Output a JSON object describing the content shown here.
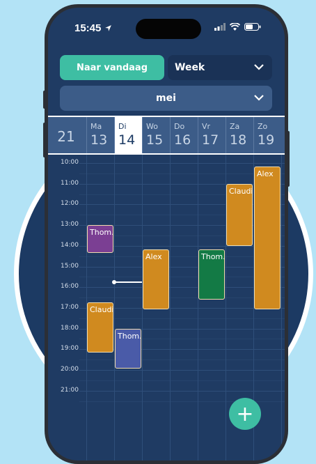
{
  "status_bar": {
    "time": "15:45"
  },
  "header": {
    "today_button": "Naar vandaag",
    "view_select": "Week",
    "month_select": "mei"
  },
  "week": {
    "number": "21",
    "days": [
      {
        "name": "Ma",
        "date": "13",
        "today": false
      },
      {
        "name": "Di",
        "date": "14",
        "today": true
      },
      {
        "name": "Wo",
        "date": "15",
        "today": false
      },
      {
        "name": "Do",
        "date": "16",
        "today": false
      },
      {
        "name": "Vr",
        "date": "17",
        "today": false
      },
      {
        "name": "Za",
        "date": "18",
        "today": false
      },
      {
        "name": "Zo",
        "date": "19",
        "today": false
      }
    ]
  },
  "hours": [
    "10:00",
    "11:00",
    "12:00",
    "13:00",
    "14:00",
    "15:00",
    "16:00",
    "17:00",
    "18:00",
    "19:00",
    "20:00",
    "21:00"
  ],
  "events": [
    {
      "title": "Thom.",
      "day": 0,
      "start": "13:00",
      "end": "14:20",
      "color": "#7b3f93"
    },
    {
      "title": "Claudi",
      "day": 0,
      "start": "16:45",
      "end": "19:10",
      "color": "#d08a1f"
    },
    {
      "title": "Thom.",
      "day": 1,
      "start": "18:00",
      "end": "19:55",
      "color": "#4a5ba8"
    },
    {
      "title": "Alex",
      "day": 2,
      "start": "14:10",
      "end": "17:05",
      "color": "#d08a1f"
    },
    {
      "title": "Thom.",
      "day": 4,
      "start": "14:10",
      "end": "16:35",
      "color": "#137a45"
    },
    {
      "title": "Claudi",
      "day": 5,
      "start": "11:00",
      "end": "14:00",
      "color": "#d08a1f"
    },
    {
      "title": "Alex",
      "day": 6,
      "start": "10:10",
      "end": "17:05",
      "color": "#d08a1f"
    }
  ],
  "now": {
    "time": "15:45",
    "day": 1
  },
  "colors": {
    "accent": "#3ebea3",
    "background": "#1f3b63",
    "page": "#b3e3f6"
  }
}
